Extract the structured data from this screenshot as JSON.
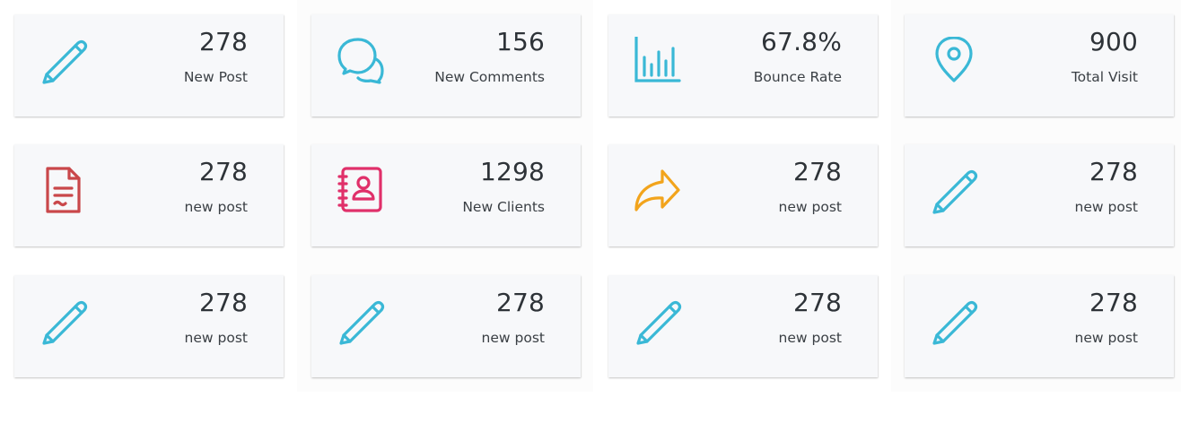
{
  "colors": {
    "blue": "#3ab8d6",
    "red": "#c9474a",
    "pink": "#e0306a",
    "orange": "#f2a41c"
  },
  "cards": [
    {
      "value": "278",
      "label": "New Post",
      "icon": "pencil-icon",
      "color": "#3ab8d6"
    },
    {
      "value": "156",
      "label": "New Comments",
      "icon": "chat-bubbles-icon",
      "color": "#3ab8d6"
    },
    {
      "value": "67.8%",
      "label": "Bounce Rate",
      "icon": "bar-chart-icon",
      "color": "#3ab8d6"
    },
    {
      "value": "900",
      "label": "Total Visit",
      "icon": "map-pin-icon",
      "color": "#3ab8d6"
    },
    {
      "value": "278",
      "label": "new post",
      "icon": "document-icon",
      "color": "#c9474a"
    },
    {
      "value": "1298",
      "label": "New Clients",
      "icon": "contact-book-icon",
      "color": "#e0306a"
    },
    {
      "value": "278",
      "label": "new post",
      "icon": "share-arrow-icon",
      "color": "#f2a41c"
    },
    {
      "value": "278",
      "label": "new post",
      "icon": "pencil-icon",
      "color": "#3ab8d6"
    },
    {
      "value": "278",
      "label": "new post",
      "icon": "pencil-icon",
      "color": "#3ab8d6"
    },
    {
      "value": "278",
      "label": "new post",
      "icon": "pencil-icon",
      "color": "#3ab8d6"
    },
    {
      "value": "278",
      "label": "new post",
      "icon": "pencil-icon",
      "color": "#3ab8d6"
    },
    {
      "value": "278",
      "label": "new post",
      "icon": "pencil-icon",
      "color": "#3ab8d6"
    }
  ]
}
